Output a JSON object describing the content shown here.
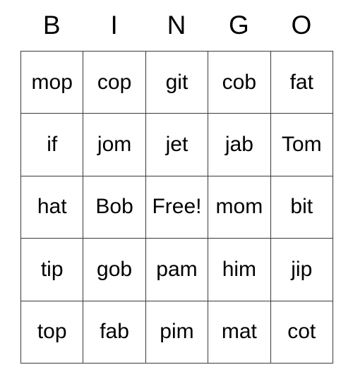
{
  "card": {
    "header_letters": [
      "B",
      "I",
      "N",
      "G",
      "O"
    ],
    "free_space_label": "Free!",
    "text_color": "#000000",
    "border_color": "#3a3a3a",
    "background_color": "#ffffff",
    "rows": [
      [
        "mop",
        "cop",
        "git",
        "cob",
        "fat"
      ],
      [
        "if",
        "jom",
        "jet",
        "jab",
        "Tom"
      ],
      [
        "hat",
        "Bob",
        "Free!",
        "mom",
        "bit"
      ],
      [
        "tip",
        "gob",
        "pam",
        "him",
        "jip"
      ],
      [
        "top",
        "fab",
        "pim",
        "mat",
        "cot"
      ]
    ]
  }
}
